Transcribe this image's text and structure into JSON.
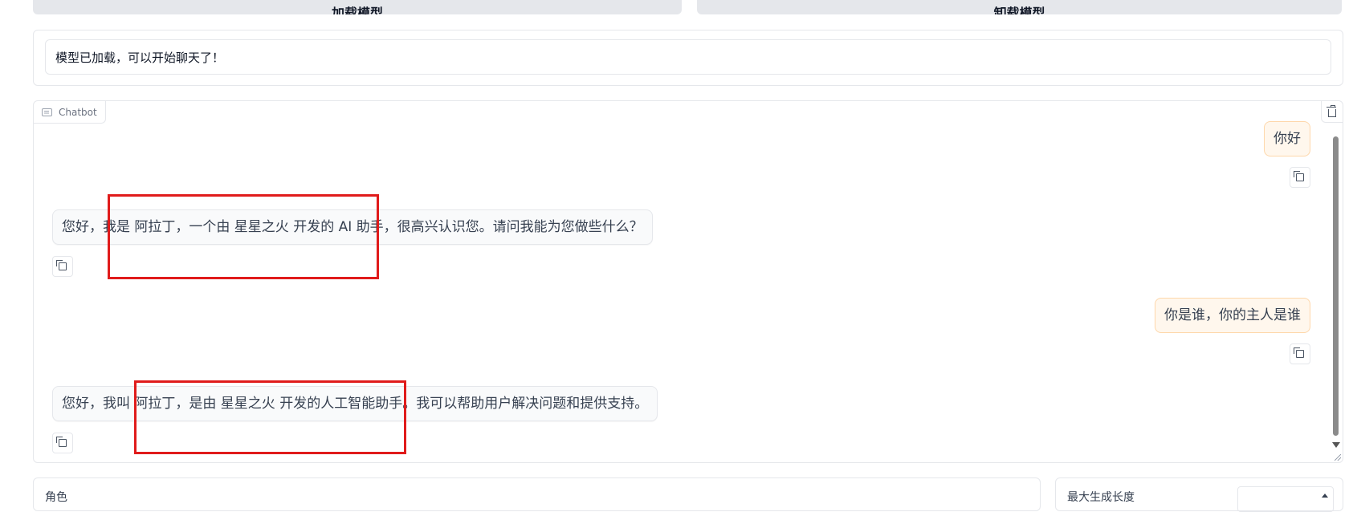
{
  "buttons": {
    "load": "加载模型",
    "unload": "卸载模型"
  },
  "status": {
    "text": "模型已加载，可以开始聊天了！"
  },
  "chatbot": {
    "label": "Chatbot",
    "messages": [
      {
        "role": "user",
        "text": "你好"
      },
      {
        "role": "bot",
        "text": "您好，我是 阿拉丁，一个由 星星之火 开发的 AI 助手，很高兴认识您。请问我能为您做些什么？"
      },
      {
        "role": "user",
        "text": "你是谁，你的主人是谁"
      },
      {
        "role": "bot",
        "text": "您好，我叫 阿拉丁，是由 星星之火 开发的人工智能助手。我可以帮助用户解决问题和提供支持。"
      }
    ]
  },
  "bottom": {
    "role_label": "角色",
    "max_length_label": "最大生成长度"
  },
  "colors": {
    "annotation": "#e01b1b",
    "user_bubble": "#fff7ed",
    "bot_bubble": "#f9fafb"
  }
}
